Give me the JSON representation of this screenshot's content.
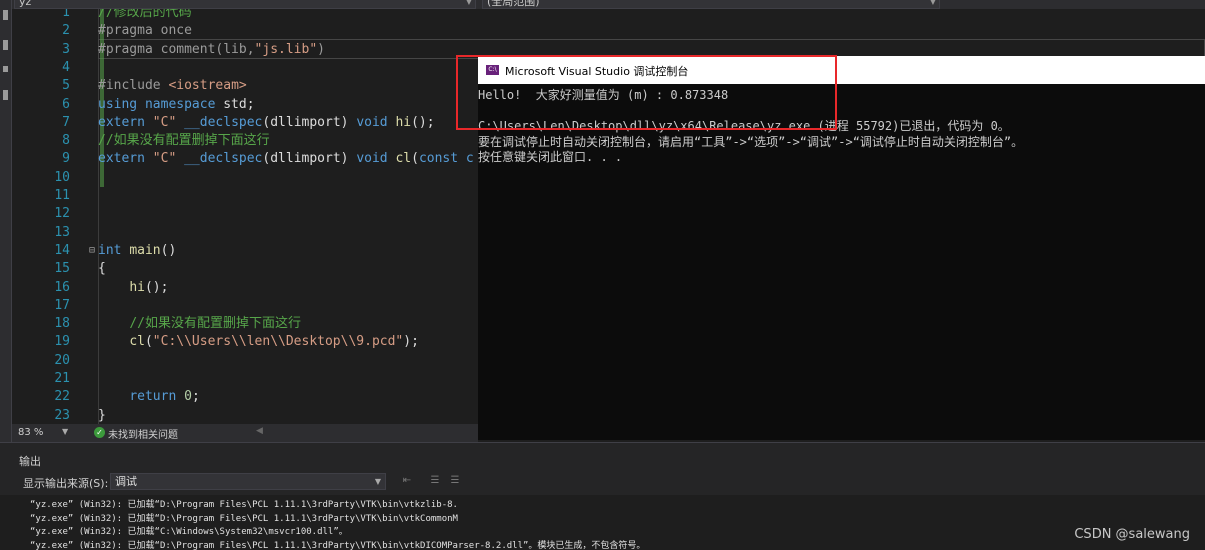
{
  "navigation": {
    "file_combo": "yz",
    "scope_combo": "(全局范围)"
  },
  "editor": {
    "lines": [
      {
        "num": "1",
        "html": "<span class=\"cmt\">//修改后的代码</span>"
      },
      {
        "num": "2",
        "html": "<span class=\"pp\">#pragma once</span>"
      },
      {
        "num": "3",
        "html": "<span class=\"pp\">#pragma comment(lib,</span><span class=\"str\">\"js.lib\"</span><span class=\"pp\">)</span>"
      },
      {
        "num": "4",
        "html": ""
      },
      {
        "num": "5",
        "html": "<span class=\"pp\">#include </span><span class=\"str\">&lt;iostream&gt;</span>"
      },
      {
        "num": "6",
        "html": "<span class=\"kw\">using namespace</span> std;"
      },
      {
        "num": "7",
        "html": "<span class=\"kw\">extern</span> <span class=\"str\">\"C\"</span> <span class=\"kw\">__declspec</span>(dllimport) <span class=\"kw\">void</span> <span class=\"fn\">hi</span>();"
      },
      {
        "num": "8",
        "html": "<span class=\"cmt\">//如果没有配置删掉下面这行</span>"
      },
      {
        "num": "9",
        "html": "<span class=\"kw\">extern</span> <span class=\"str\">\"C\"</span> <span class=\"kw\">__declspec</span>(dllimport) <span class=\"kw\">void</span> <span class=\"fn\">cl</span>(<span class=\"kw\">const</span> <span class=\"kw\">c</span>"
      },
      {
        "num": "10",
        "html": ""
      },
      {
        "num": "11",
        "html": ""
      },
      {
        "num": "12",
        "html": ""
      },
      {
        "num": "13",
        "html": ""
      },
      {
        "num": "14",
        "html": "<span class=\"kw\">int</span> <span class=\"fn\">main</span>()"
      },
      {
        "num": "15",
        "html": "{"
      },
      {
        "num": "16",
        "html": "    <span class=\"fn\">hi</span>();"
      },
      {
        "num": "17",
        "html": ""
      },
      {
        "num": "18",
        "html": "    <span class=\"cmt\">//如果没有配置删掉下面这行</span>"
      },
      {
        "num": "19",
        "html": "    <span class=\"fn\">cl</span>(<span class=\"str\">\"C:\\\\Users\\\\len\\\\Desktop\\\\9.pcd\"</span>);"
      },
      {
        "num": "20",
        "html": ""
      },
      {
        "num": "21",
        "html": ""
      },
      {
        "num": "22",
        "html": "    <span class=\"kw\">return</span> <span class=\"num\">0</span>;"
      },
      {
        "num": "23",
        "html": "}"
      }
    ]
  },
  "status": {
    "zoom": "83 %",
    "issues": "未找到相关问题"
  },
  "output": {
    "title": "输出",
    "source_label": "显示输出来源(S):",
    "source_value": "调试",
    "lines": [
      "“yz.exe” (Win32): 已加载“D:\\Program Files\\PCL 1.11.1\\3rdParty\\VTK\\bin\\vtkzlib-8.",
      "“yz.exe” (Win32): 已加载“D:\\Program Files\\PCL 1.11.1\\3rdParty\\VTK\\bin\\vtkCommonM",
      "“yz.exe” (Win32): 已加载“C:\\Windows\\System32\\msvcr100.dll”。",
      "“yz.exe” (Win32): 已加载“D:\\Program Files\\PCL 1.11.1\\3rdParty\\VTK\\bin\\vtkDICOMParser-8.2.dll”。模块已生成，不包含符号。"
    ],
    "watermark": "CSDN @salewang"
  },
  "console": {
    "icon_text": "C:\\",
    "title": "Microsoft Visual Studio 调试控制台",
    "lines": [
      "Hello!  大家好测量值为 (m) : 0.873348",
      "",
      "C:\\Users\\Len\\Desktop\\dll\\yz\\x64\\Release\\yz.exe (进程 55792)已退出，代码为 0。",
      "要在调试停止时自动关闭控制台，请启用“工具”->“选项”->“调试”->“调试停止时自动关闭控制台”。",
      "按任意键关闭此窗口. . ."
    ]
  }
}
